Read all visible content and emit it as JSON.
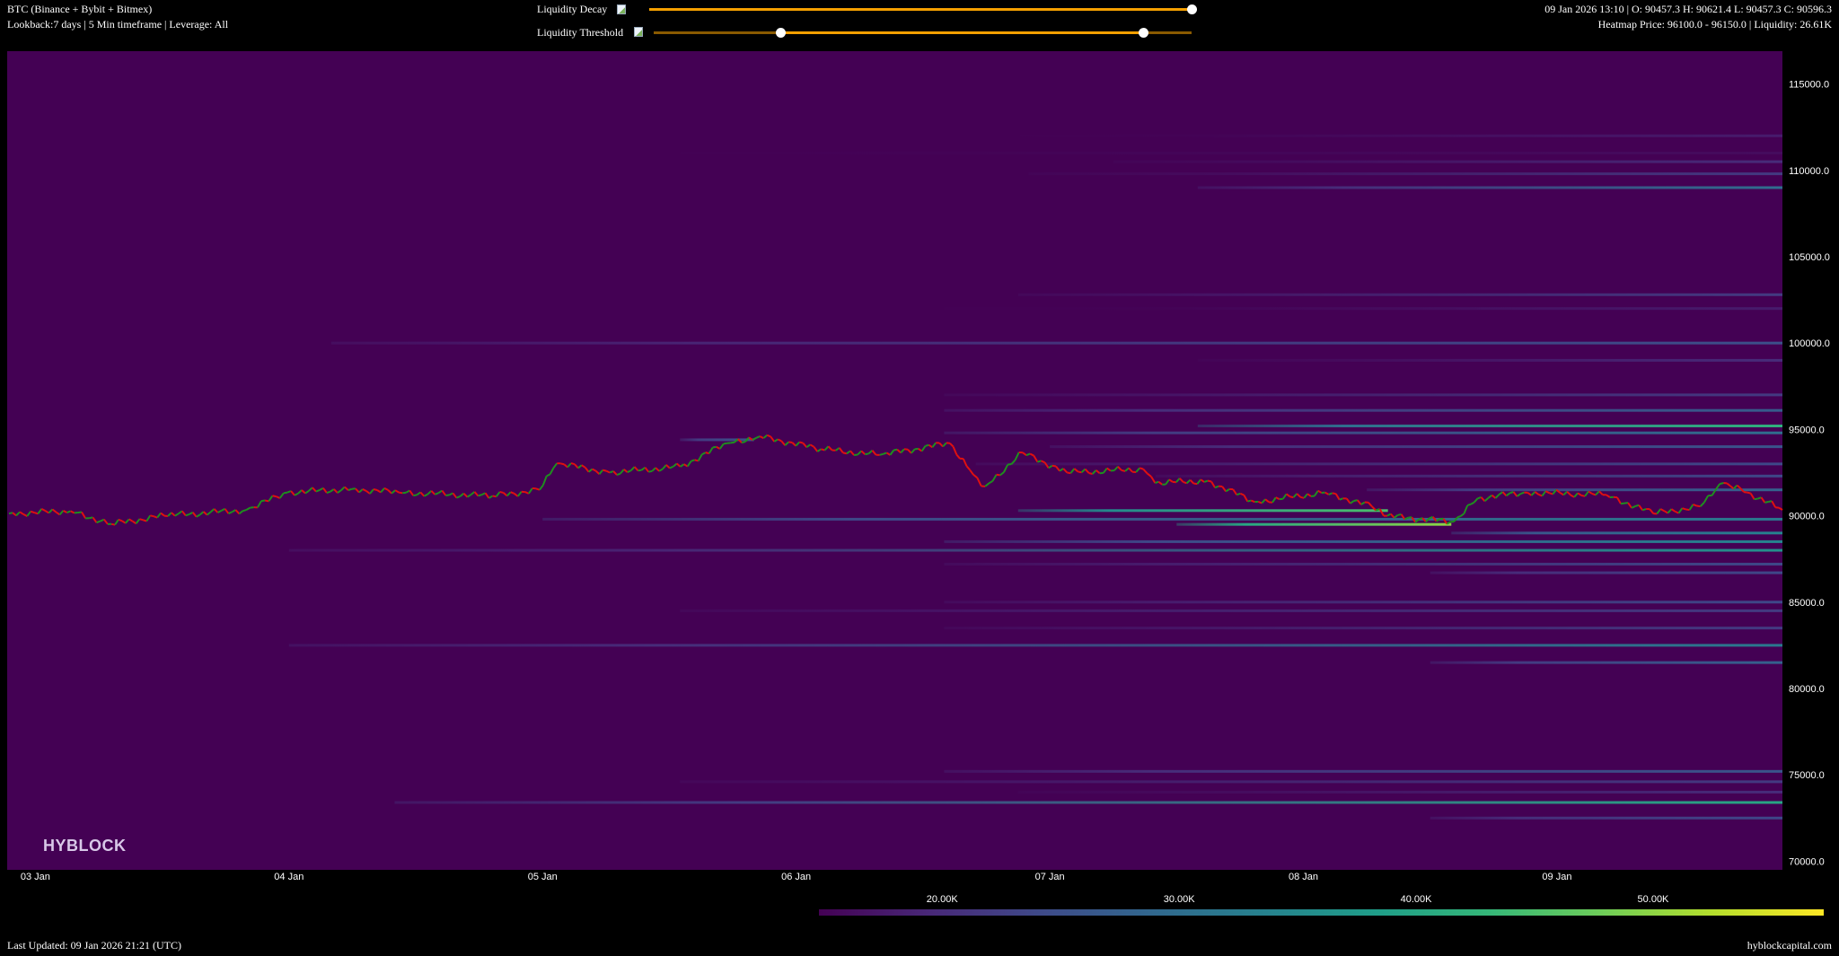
{
  "header": {
    "title": "BTC (Binance + Bybit + Bitmex)",
    "subtitle": "Lookback:7 days | 5 Min timeframe | Leverage: All",
    "ohlc": "09 Jan 2026 13:10 | O: 90457.3 H: 90621.4 L: 90457.3 C: 90596.3",
    "heatmap_info": "Heatmap Price: 96100.0 - 96150.0 | Liquidity: 26.61K"
  },
  "controls": {
    "liquidity_decay": {
      "label": "Liquidity Decay",
      "icon": "broken-image-icon",
      "value": 1.0
    },
    "liquidity_threshold": {
      "label": "Liquidity Threshold",
      "icon": "broken-image-icon",
      "range": [
        0.235,
        0.91
      ]
    },
    "accent_color": "#f5a000"
  },
  "watermark": "HYBLOCK",
  "footer": {
    "last_updated": "Last Updated: 09 Jan 2026 21:21 (UTC)",
    "site": "hyblockcapital.com"
  },
  "colors": {
    "background": "#440154",
    "up": "#1f8f1f",
    "down": "#e01010",
    "colormap": "viridis"
  },
  "chart_data": {
    "type": "heatmap",
    "xlim": [
      "2026-01-02 21:20",
      "2026-01-09 21:20"
    ],
    "ylim": [
      69500,
      116900
    ],
    "x_ticks": [
      {
        "label": "03 Jan",
        "t": "2026-01-03 00:00"
      },
      {
        "label": "04 Jan",
        "t": "2026-01-04 00:00"
      },
      {
        "label": "05 Jan",
        "t": "2026-01-05 00:00"
      },
      {
        "label": "06 Jan",
        "t": "2026-01-06 00:00"
      },
      {
        "label": "07 Jan",
        "t": "2026-01-07 00:00"
      },
      {
        "label": "08 Jan",
        "t": "2026-01-08 00:00"
      },
      {
        "label": "09 Jan",
        "t": "2026-01-09 00:00"
      }
    ],
    "y_ticks": [
      {
        "label": "115000.0",
        "v": 115000
      },
      {
        "label": "110000.0",
        "v": 110000
      },
      {
        "label": "105000.0",
        "v": 105000
      },
      {
        "label": "100000.0",
        "v": 100000
      },
      {
        "label": "95000.0",
        "v": 95000
      },
      {
        "label": "90000.0",
        "v": 90000
      },
      {
        "label": "85000.0",
        "v": 85000
      },
      {
        "label": "80000.0",
        "v": 80000
      },
      {
        "label": "75000.0",
        "v": 75000
      },
      {
        "label": "70000.0",
        "v": 70000
      }
    ],
    "colorbar": {
      "range": [
        14.8,
        57.2
      ],
      "ticks": [
        {
          "label": "20.00K",
          "v": 20
        },
        {
          "label": "30.00K",
          "v": 30
        },
        {
          "label": "40.00K",
          "v": 40
        },
        {
          "label": "50.00K",
          "v": 50
        }
      ]
    },
    "price": [
      [
        "2026-01-02 21:30",
        90130
      ],
      [
        "2026-01-03 03:20",
        90270
      ],
      [
        "2026-01-03 07:12",
        89520
      ],
      [
        "2026-01-03 12:12",
        90000
      ],
      [
        "2026-01-03 19:58",
        90340
      ],
      [
        "2026-01-03 23:51",
        91350
      ],
      [
        "2026-01-04 05:57",
        91550
      ],
      [
        "2026-01-04 10:24",
        91350
      ],
      [
        "2026-01-04 19:16",
        91150
      ],
      [
        "2026-01-04 23:43",
        91500
      ],
      [
        "2026-01-05 01:22",
        93040
      ],
      [
        "2026-01-05 06:22",
        92500
      ],
      [
        "2026-01-05 13:02",
        92840
      ],
      [
        "2026-01-05 17:28",
        94200
      ],
      [
        "2026-01-05 20:34",
        94600
      ],
      [
        "2026-01-06 02:21",
        93860
      ],
      [
        "2026-01-06 07:54",
        93520
      ],
      [
        "2026-01-06 14:33",
        94200
      ],
      [
        "2026-01-06 16:46",
        92380
      ],
      [
        "2026-01-06 17:53",
        91700
      ],
      [
        "2026-01-06 21:26",
        93660
      ],
      [
        "2026-01-07 01:38",
        92500
      ],
      [
        "2026-01-07 08:51",
        92700
      ],
      [
        "2026-01-07 09:58",
        91900
      ],
      [
        "2026-01-07 14:57",
        92030
      ],
      [
        "2026-01-07 19:24",
        90800
      ],
      [
        "2026-01-08 02:03",
        91350
      ],
      [
        "2026-01-08 06:29",
        90540
      ],
      [
        "2026-01-08 07:36",
        90000
      ],
      [
        "2026-01-08 14:15",
        89660
      ],
      [
        "2026-01-08 16:29",
        91000
      ],
      [
        "2026-01-08 20:54",
        91350
      ],
      [
        "2026-01-09 04:40",
        91210
      ],
      [
        "2026-01-09 09:07",
        90130
      ],
      [
        "2026-01-09 13:34",
        90540
      ],
      [
        "2026-01-09 15:46",
        91900
      ],
      [
        "2026-01-09 18:00",
        91350
      ],
      [
        "2026-01-09 21:20",
        90340
      ]
    ],
    "liquidity_bands": [
      {
        "price": 112000,
        "start": "2026-01-06 21:10",
        "end": null,
        "liquidity": [
          15,
          18
        ]
      },
      {
        "price": 111000,
        "start": "2026-01-05 13:00",
        "end": null,
        "liquidity": [
          15,
          16
        ]
      },
      {
        "price": 110500,
        "start": "2026-01-07 06:00",
        "end": null,
        "liquidity": [
          16,
          20
        ]
      },
      {
        "price": 109800,
        "start": "2026-01-06 22:00",
        "end": null,
        "liquidity": [
          16,
          22
        ]
      },
      {
        "price": 109000,
        "start": "2026-01-07 14:00",
        "end": null,
        "liquidity": [
          20,
          30
        ]
      },
      {
        "price": 102800,
        "start": "2026-01-06 21:00",
        "end": null,
        "liquidity": [
          17,
          22
        ]
      },
      {
        "price": 102000,
        "start": "2026-01-06 14:00",
        "end": null,
        "liquidity": [
          15,
          18
        ]
      },
      {
        "price": 100000,
        "start": "2026-01-04 04:00",
        "end": null,
        "liquidity": [
          19,
          25
        ]
      },
      {
        "price": 99000,
        "start": "2026-01-07 14:00",
        "end": null,
        "liquidity": [
          16,
          20
        ]
      },
      {
        "price": 97000,
        "start": "2026-01-06 14:00",
        "end": null,
        "liquidity": [
          17,
          22
        ]
      },
      {
        "price": 96100,
        "start": "2026-01-06 14:00",
        "end": null,
        "liquidity": [
          20,
          27
        ]
      },
      {
        "price": 95200,
        "start": "2026-01-07 14:00",
        "end": null,
        "liquidity": [
          30,
          42
        ]
      },
      {
        "price": 94800,
        "start": "2026-01-06 14:00",
        "end": null,
        "liquidity": [
          22,
          30
        ]
      },
      {
        "price": 94400,
        "start": "2026-01-05 13:00",
        "end": "2026-01-05 20:00",
        "liquidity": [
          22,
          26
        ]
      },
      {
        "price": 94000,
        "start": "2026-01-07 00:00",
        "end": null,
        "liquidity": [
          20,
          26
        ]
      },
      {
        "price": 93000,
        "start": "2026-01-06 17:00",
        "end": null,
        "liquidity": [
          18,
          24
        ]
      },
      {
        "price": 92300,
        "start": "2026-01-07 10:00",
        "end": null,
        "liquidity": [
          18,
          24
        ]
      },
      {
        "price": 91500,
        "start": "2026-01-08 06:00",
        "end": null,
        "liquidity": [
          22,
          28
        ]
      },
      {
        "price": 90300,
        "start": "2026-01-06 21:00",
        "end": "2026-01-08 08:00",
        "liquidity": [
          35,
          45
        ]
      },
      {
        "price": 89800,
        "start": "2026-01-05 00:00",
        "end": null,
        "liquidity": [
          24,
          32
        ]
      },
      {
        "price": 89500,
        "start": "2026-01-07 12:00",
        "end": "2026-01-08 14:00",
        "liquidity": [
          40,
          50
        ]
      },
      {
        "price": 89000,
        "start": "2026-01-08 14:00",
        "end": null,
        "liquidity": [
          26,
          34
        ]
      },
      {
        "price": 88500,
        "start": "2026-01-06 14:00",
        "end": null,
        "liquidity": [
          24,
          34
        ]
      },
      {
        "price": 88000,
        "start": "2026-01-04 00:00",
        "end": null,
        "liquidity": [
          19,
          36
        ]
      },
      {
        "price": 87200,
        "start": "2026-01-06 14:00",
        "end": null,
        "liquidity": [
          18,
          24
        ]
      },
      {
        "price": 86700,
        "start": "2026-01-08 12:00",
        "end": null,
        "liquidity": [
          20,
          24
        ]
      },
      {
        "price": 85000,
        "start": "2026-01-06 14:00",
        "end": null,
        "liquidity": [
          18,
          24
        ]
      },
      {
        "price": 84500,
        "start": "2026-01-05 13:00",
        "end": null,
        "liquidity": [
          17,
          22
        ]
      },
      {
        "price": 83500,
        "start": "2026-01-06 14:00",
        "end": null,
        "liquidity": [
          17,
          22
        ]
      },
      {
        "price": 82500,
        "start": "2026-01-04 00:00",
        "end": null,
        "liquidity": [
          20,
          32
        ]
      },
      {
        "price": 81500,
        "start": "2026-01-08 12:00",
        "end": null,
        "liquidity": [
          22,
          28
        ]
      },
      {
        "price": 75200,
        "start": "2026-01-06 14:00",
        "end": null,
        "liquidity": [
          20,
          26
        ]
      },
      {
        "price": 74600,
        "start": "2026-01-05 13:00",
        "end": null,
        "liquidity": [
          17,
          22
        ]
      },
      {
        "price": 74000,
        "start": "2026-01-06 21:00",
        "end": null,
        "liquidity": [
          16,
          20
        ]
      },
      {
        "price": 73400,
        "start": "2026-01-04 10:00",
        "end": null,
        "liquidity": [
          22,
          40
        ]
      },
      {
        "price": 72500,
        "start": "2026-01-08 12:00",
        "end": null,
        "liquidity": [
          20,
          24
        ]
      }
    ]
  }
}
